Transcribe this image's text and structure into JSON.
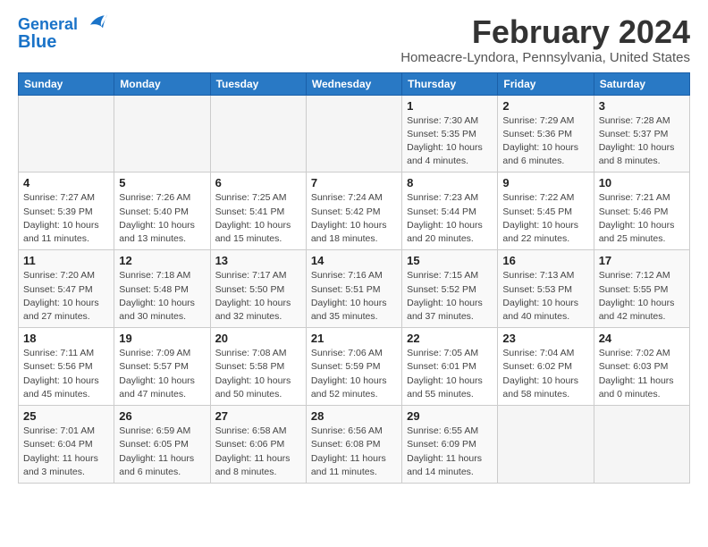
{
  "header": {
    "logo_line1": "General",
    "logo_line2": "Blue",
    "title": "February 2024",
    "subtitle": "Homeacre-Lyndora, Pennsylvania, United States"
  },
  "days_of_week": [
    "Sunday",
    "Monday",
    "Tuesday",
    "Wednesday",
    "Thursday",
    "Friday",
    "Saturday"
  ],
  "weeks": [
    [
      {
        "day": "",
        "info": ""
      },
      {
        "day": "",
        "info": ""
      },
      {
        "day": "",
        "info": ""
      },
      {
        "day": "",
        "info": ""
      },
      {
        "day": "1",
        "info": "Sunrise: 7:30 AM\nSunset: 5:35 PM\nDaylight: 10 hours\nand 4 minutes."
      },
      {
        "day": "2",
        "info": "Sunrise: 7:29 AM\nSunset: 5:36 PM\nDaylight: 10 hours\nand 6 minutes."
      },
      {
        "day": "3",
        "info": "Sunrise: 7:28 AM\nSunset: 5:37 PM\nDaylight: 10 hours\nand 8 minutes."
      }
    ],
    [
      {
        "day": "4",
        "info": "Sunrise: 7:27 AM\nSunset: 5:39 PM\nDaylight: 10 hours\nand 11 minutes."
      },
      {
        "day": "5",
        "info": "Sunrise: 7:26 AM\nSunset: 5:40 PM\nDaylight: 10 hours\nand 13 minutes."
      },
      {
        "day": "6",
        "info": "Sunrise: 7:25 AM\nSunset: 5:41 PM\nDaylight: 10 hours\nand 15 minutes."
      },
      {
        "day": "7",
        "info": "Sunrise: 7:24 AM\nSunset: 5:42 PM\nDaylight: 10 hours\nand 18 minutes."
      },
      {
        "day": "8",
        "info": "Sunrise: 7:23 AM\nSunset: 5:44 PM\nDaylight: 10 hours\nand 20 minutes."
      },
      {
        "day": "9",
        "info": "Sunrise: 7:22 AM\nSunset: 5:45 PM\nDaylight: 10 hours\nand 22 minutes."
      },
      {
        "day": "10",
        "info": "Sunrise: 7:21 AM\nSunset: 5:46 PM\nDaylight: 10 hours\nand 25 minutes."
      }
    ],
    [
      {
        "day": "11",
        "info": "Sunrise: 7:20 AM\nSunset: 5:47 PM\nDaylight: 10 hours\nand 27 minutes."
      },
      {
        "day": "12",
        "info": "Sunrise: 7:18 AM\nSunset: 5:48 PM\nDaylight: 10 hours\nand 30 minutes."
      },
      {
        "day": "13",
        "info": "Sunrise: 7:17 AM\nSunset: 5:50 PM\nDaylight: 10 hours\nand 32 minutes."
      },
      {
        "day": "14",
        "info": "Sunrise: 7:16 AM\nSunset: 5:51 PM\nDaylight: 10 hours\nand 35 minutes."
      },
      {
        "day": "15",
        "info": "Sunrise: 7:15 AM\nSunset: 5:52 PM\nDaylight: 10 hours\nand 37 minutes."
      },
      {
        "day": "16",
        "info": "Sunrise: 7:13 AM\nSunset: 5:53 PM\nDaylight: 10 hours\nand 40 minutes."
      },
      {
        "day": "17",
        "info": "Sunrise: 7:12 AM\nSunset: 5:55 PM\nDaylight: 10 hours\nand 42 minutes."
      }
    ],
    [
      {
        "day": "18",
        "info": "Sunrise: 7:11 AM\nSunset: 5:56 PM\nDaylight: 10 hours\nand 45 minutes."
      },
      {
        "day": "19",
        "info": "Sunrise: 7:09 AM\nSunset: 5:57 PM\nDaylight: 10 hours\nand 47 minutes."
      },
      {
        "day": "20",
        "info": "Sunrise: 7:08 AM\nSunset: 5:58 PM\nDaylight: 10 hours\nand 50 minutes."
      },
      {
        "day": "21",
        "info": "Sunrise: 7:06 AM\nSunset: 5:59 PM\nDaylight: 10 hours\nand 52 minutes."
      },
      {
        "day": "22",
        "info": "Sunrise: 7:05 AM\nSunset: 6:01 PM\nDaylight: 10 hours\nand 55 minutes."
      },
      {
        "day": "23",
        "info": "Sunrise: 7:04 AM\nSunset: 6:02 PM\nDaylight: 10 hours\nand 58 minutes."
      },
      {
        "day": "24",
        "info": "Sunrise: 7:02 AM\nSunset: 6:03 PM\nDaylight: 11 hours\nand 0 minutes."
      }
    ],
    [
      {
        "day": "25",
        "info": "Sunrise: 7:01 AM\nSunset: 6:04 PM\nDaylight: 11 hours\nand 3 minutes."
      },
      {
        "day": "26",
        "info": "Sunrise: 6:59 AM\nSunset: 6:05 PM\nDaylight: 11 hours\nand 6 minutes."
      },
      {
        "day": "27",
        "info": "Sunrise: 6:58 AM\nSunset: 6:06 PM\nDaylight: 11 hours\nand 8 minutes."
      },
      {
        "day": "28",
        "info": "Sunrise: 6:56 AM\nSunset: 6:08 PM\nDaylight: 11 hours\nand 11 minutes."
      },
      {
        "day": "29",
        "info": "Sunrise: 6:55 AM\nSunset: 6:09 PM\nDaylight: 11 hours\nand 14 minutes."
      },
      {
        "day": "",
        "info": ""
      },
      {
        "day": "",
        "info": ""
      }
    ]
  ]
}
